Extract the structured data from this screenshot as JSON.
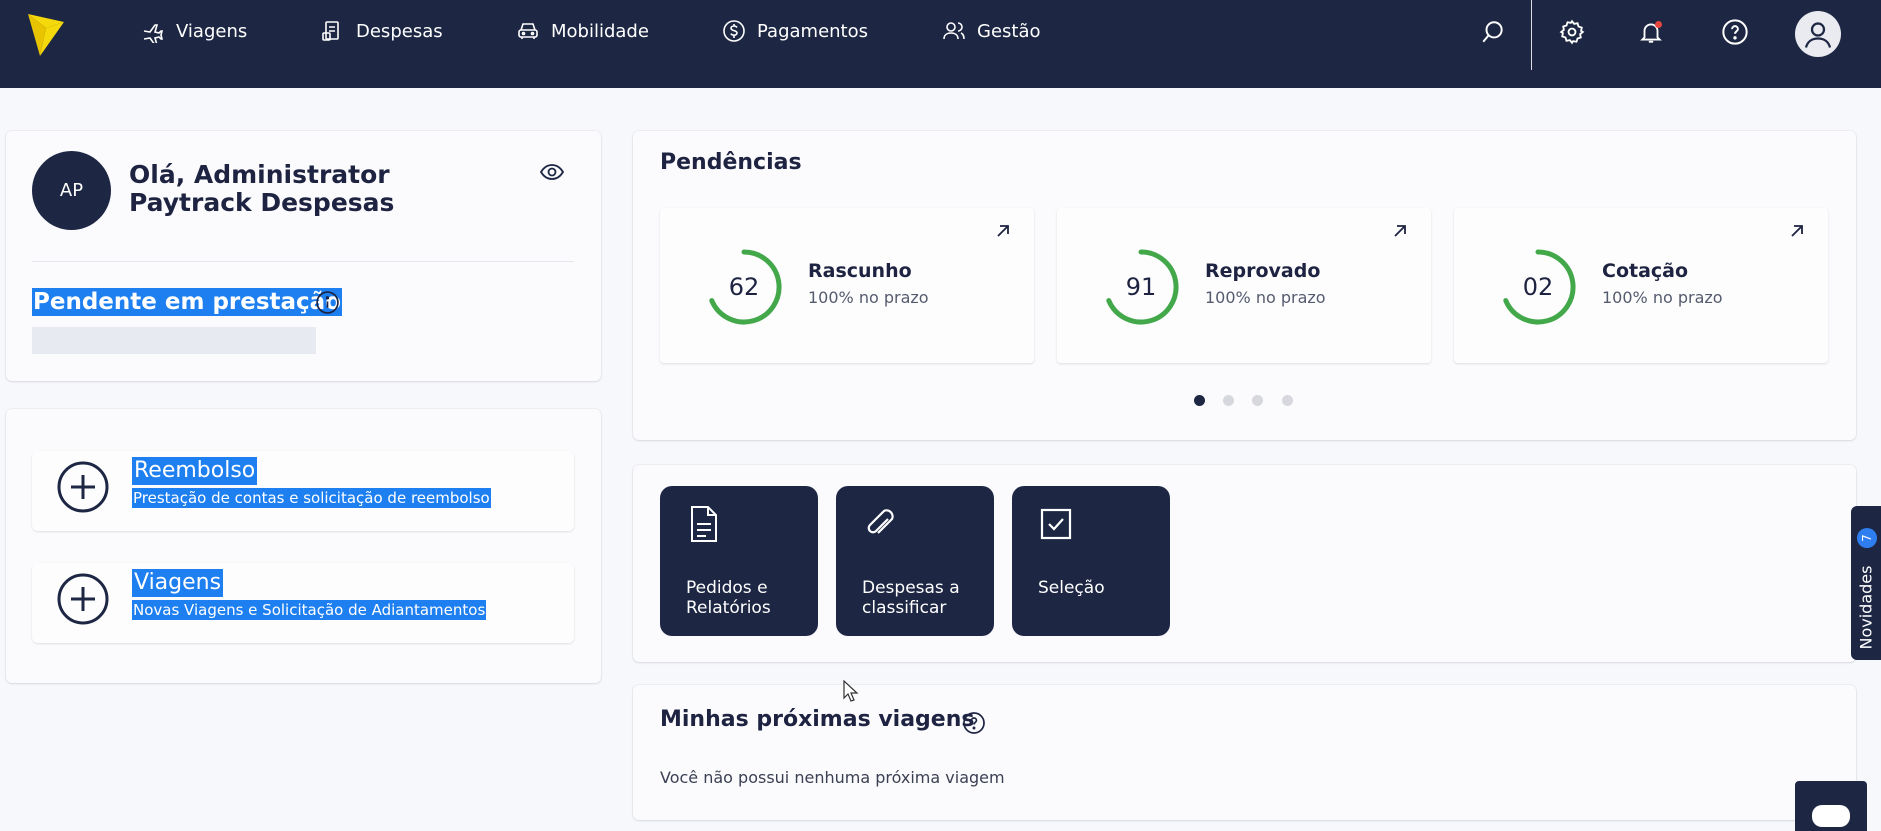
{
  "nav": {
    "items": [
      {
        "label": "Viagens",
        "icon": "airplane-icon"
      },
      {
        "label": "Despesas",
        "icon": "receipt-icon"
      },
      {
        "label": "Mobilidade",
        "icon": "car-icon"
      },
      {
        "label": "Pagamentos",
        "icon": "dollar-circle-icon"
      },
      {
        "label": "Gestão",
        "icon": "users-icon"
      }
    ],
    "right_icons": [
      "search-icon",
      "gear-icon",
      "bell-icon",
      "help-icon",
      "user-avatar-icon"
    ]
  },
  "profile": {
    "initials": "AP",
    "greeting": "Olá, Administrator Paytrack Despesas",
    "pending_label": "Pendente em prestação"
  },
  "actions": [
    {
      "title": "Reembolso",
      "description": "Prestação de contas e solicitação de reembolso"
    },
    {
      "title": "Viagens",
      "description": "Novas Viagens e Solicitação de Adiantamentos"
    }
  ],
  "pendencias": {
    "title": "Pendências",
    "cards": [
      {
        "value": "62",
        "name": "Rascunho",
        "sub": "100% no prazo",
        "progress": 1.0
      },
      {
        "value": "91",
        "name": "Reprovado",
        "sub": "100% no prazo",
        "progress": 1.0
      },
      {
        "value": "02",
        "name": "Cotação",
        "sub": "100% no prazo",
        "progress": 1.0
      }
    ],
    "pages": 4,
    "active_page": 1
  },
  "shortcuts": [
    {
      "label": "Pedidos e Relatórios",
      "icon": "document-icon"
    },
    {
      "label": "Despesas a classificar",
      "icon": "paperclip-icon"
    },
    {
      "label": "Seleção",
      "icon": "checkbox-icon"
    }
  ],
  "trips": {
    "title": "Minhas próximas viagens",
    "empty_message": "Você não possui nenhuma próxima viagem"
  },
  "novidades": {
    "label": "Novidades",
    "count": "7"
  },
  "colors": {
    "navy": "#1d2744",
    "ring_green": "#43a84a",
    "selection_blue": "#1e7ff0",
    "logo_yellow": "#f5d90a"
  }
}
